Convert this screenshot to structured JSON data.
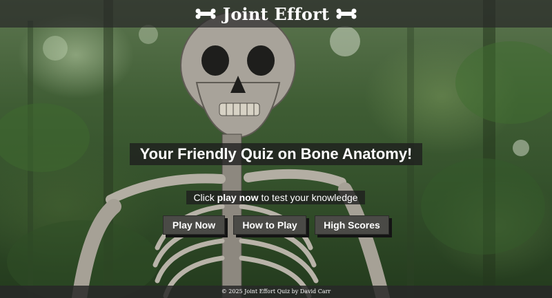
{
  "header": {
    "title": "Joint Effort",
    "left_icon": "bone-icon",
    "right_icon": "bone-icon"
  },
  "hero": {
    "tagline": "Your Friendly Quiz on Bone Anatomy!",
    "instructions_prefix": "Click ",
    "instructions_emphasis": "play now",
    "instructions_suffix": " to test your knowledge"
  },
  "buttons": {
    "play_now": "Play Now",
    "how_to_play": "How to Play",
    "high_scores": "High Scores"
  },
  "footer": {
    "text": "© 2025 Joint Effort Quiz by David Carr"
  },
  "colors": {
    "header_bg": "#282828",
    "button_bg": "#4a4a46",
    "text": "#ffffff",
    "forest_green": "#3f5d34"
  },
  "background": {
    "icon": "skeleton-forest-photo"
  }
}
